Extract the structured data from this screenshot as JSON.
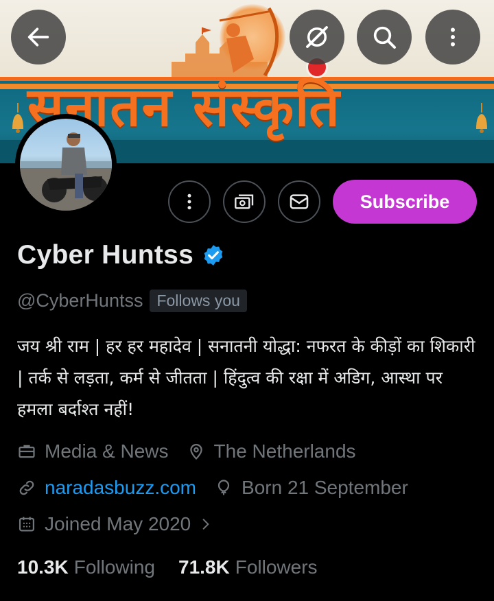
{
  "banner": {
    "title": "सनातन संस्कृति"
  },
  "header_buttons": {
    "back": "arrow-left-icon",
    "grok": "grok-icon",
    "search": "search-icon",
    "more": "more-vertical-icon"
  },
  "actions": {
    "more": "more-vertical-icon",
    "tip": "money-icon",
    "message": "mail-icon",
    "subscribe_label": "Subscribe"
  },
  "profile": {
    "name": "Cyber Huntss",
    "handle": "@CyberHuntss",
    "follows_you": "Follows you",
    "bio": "जय श्री राम | हर हर महादेव | सनातनी योद्धा: नफरत के कीड़ों का शिकारी | तर्क से लड़ता, कर्म से जीतता | हिंदुत्व की रक्षा में अडिग, आस्था पर हमला बर्दाश्त नहीं!",
    "category": "Media & News",
    "location": "The Netherlands",
    "website": "naradasbuzz.com",
    "birthday": "Born 21 September",
    "joined": "Joined May 2020"
  },
  "stats": {
    "following_count": "10.3K",
    "following_label": "Following",
    "followers_count": "71.8K",
    "followers_label": "Followers"
  },
  "colors": {
    "background": "#000000",
    "accent_blue": "#1d9bf0",
    "subscribe": "#c537d2",
    "muted_text": "#71767b",
    "banner_orange": "#f5701f",
    "banner_teal": "#16758c"
  }
}
